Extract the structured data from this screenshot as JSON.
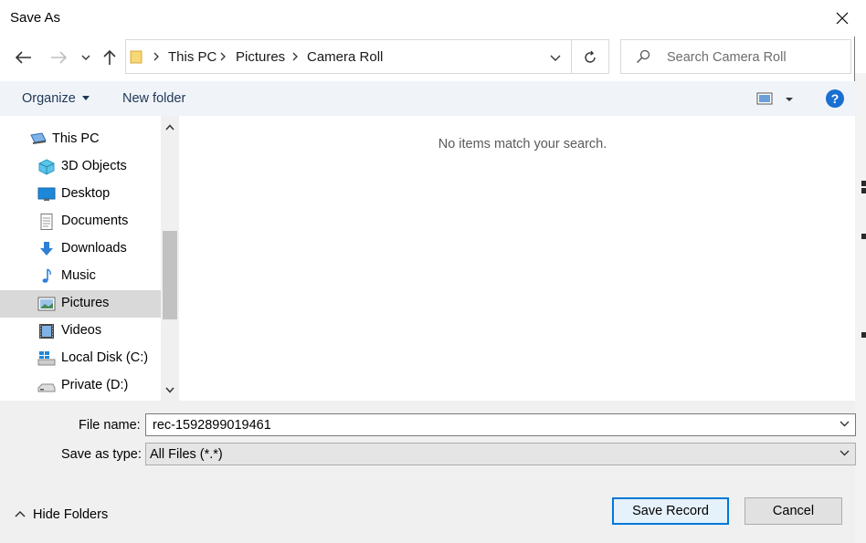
{
  "dialog": {
    "title": "Save As"
  },
  "nav": {
    "breadcrumbs": [
      "This PC",
      "Pictures",
      "Camera Roll"
    ],
    "search_placeholder": "Search Camera Roll"
  },
  "toolbar": {
    "organize_label": "Organize",
    "new_folder_label": "New folder",
    "help_label": "?"
  },
  "sidebar": {
    "items": [
      {
        "label": "This PC",
        "icon": "computer-icon"
      },
      {
        "label": "3D Objects",
        "icon": "cube-icon"
      },
      {
        "label": "Desktop",
        "icon": "desktop-icon"
      },
      {
        "label": "Documents",
        "icon": "documents-icon"
      },
      {
        "label": "Downloads",
        "icon": "downloads-icon"
      },
      {
        "label": "Music",
        "icon": "music-icon"
      },
      {
        "label": "Pictures",
        "icon": "pictures-icon",
        "selected": true
      },
      {
        "label": "Videos",
        "icon": "videos-icon"
      },
      {
        "label": "Local Disk (C:)",
        "icon": "local-disk-icon"
      },
      {
        "label": "Private (D:)",
        "icon": "drive-icon"
      }
    ]
  },
  "content": {
    "empty_message": "No items match your search."
  },
  "form": {
    "file_name_label": "File name:",
    "file_name_value": "rec-1592899019461",
    "save_type_label": "Save as type:",
    "save_type_value": "All Files (*.*)"
  },
  "footer": {
    "hide_folders_label": "Hide Folders",
    "save_button_label": "Save Record",
    "cancel_button_label": "Cancel"
  },
  "colors": {
    "accent": "#0078d7",
    "toolbar_bg": "#f0f4f9",
    "selected_bg": "#d9d9d9",
    "help_blue": "#1a6fd1"
  }
}
